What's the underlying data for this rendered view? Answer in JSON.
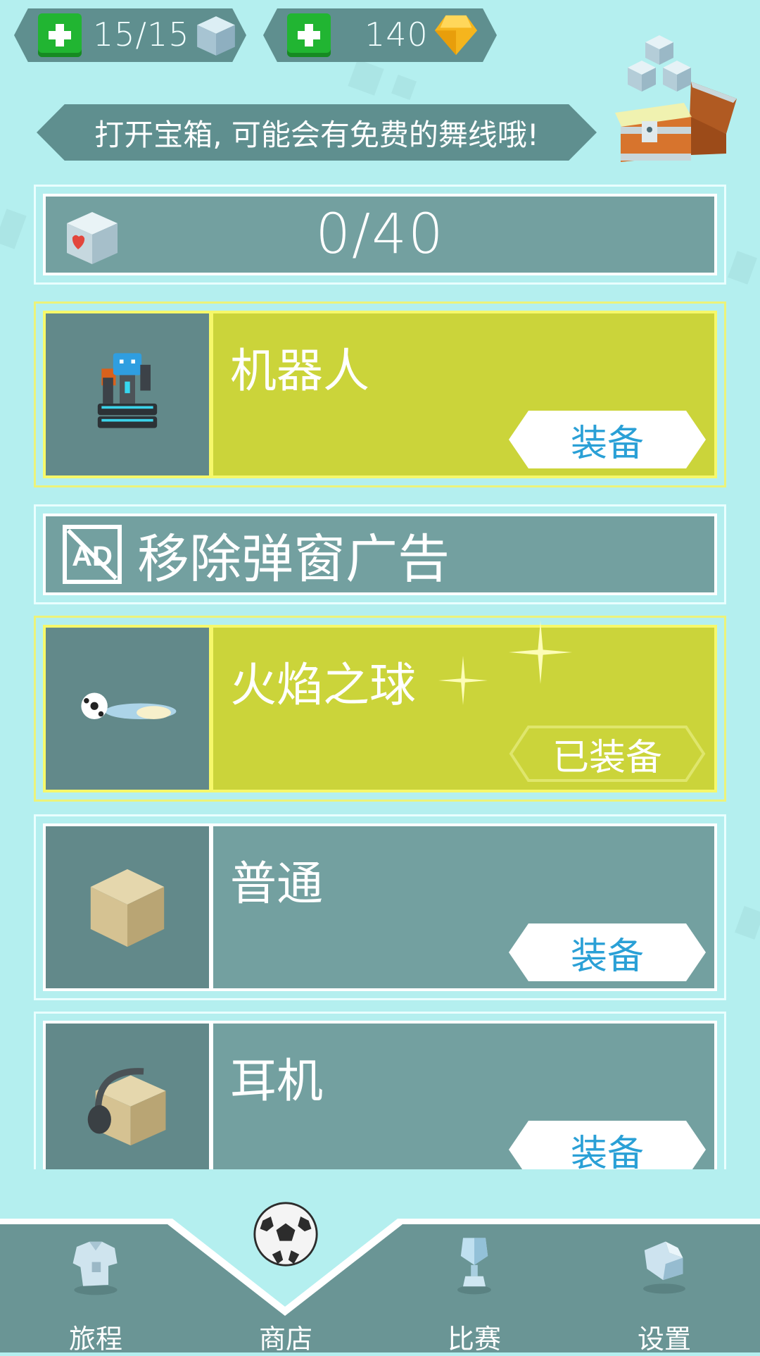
{
  "top": {
    "moves": {
      "value": "15/15",
      "icon": "ice-cube-icon"
    },
    "gems": {
      "value": "140",
      "icon": "gold-gem-icon"
    }
  },
  "banner": {
    "text": "打开宝箱, 可能会有免费的舞线哦!",
    "icon": "treasure-chest-icon"
  },
  "counter": {
    "value": "0/40",
    "icon": "heart-cube-icon"
  },
  "items": [
    {
      "name": "机器人",
      "button": "装备",
      "selected": true,
      "equipped": false,
      "icon": "robot-icon"
    },
    {
      "name": "火焰之球",
      "button": "已装备",
      "selected": true,
      "equipped": true,
      "icon": "fire-ball-icon"
    },
    {
      "name": "普通",
      "button": "装备",
      "selected": false,
      "equipped": false,
      "icon": "plain-box-icon"
    },
    {
      "name": "耳机",
      "button": "装备",
      "selected": false,
      "equipped": false,
      "icon": "headphones-box-icon"
    }
  ],
  "remove_ads": {
    "label": "移除弹窗广告",
    "icon": "no-ad-icon"
  },
  "nav": [
    {
      "label": "旅程",
      "icon": "shirt-icon"
    },
    {
      "label": "商店",
      "icon": "soccer-ball-icon"
    },
    {
      "label": "比赛",
      "icon": "trophy-icon"
    },
    {
      "label": "设置",
      "icon": "whistle-icon"
    }
  ],
  "colors": {
    "background": "#b4efef",
    "panel": "#73a0a0",
    "selected": "#cbd43a",
    "accent_blue": "#2aa0d6",
    "plus_green": "#21b532"
  }
}
